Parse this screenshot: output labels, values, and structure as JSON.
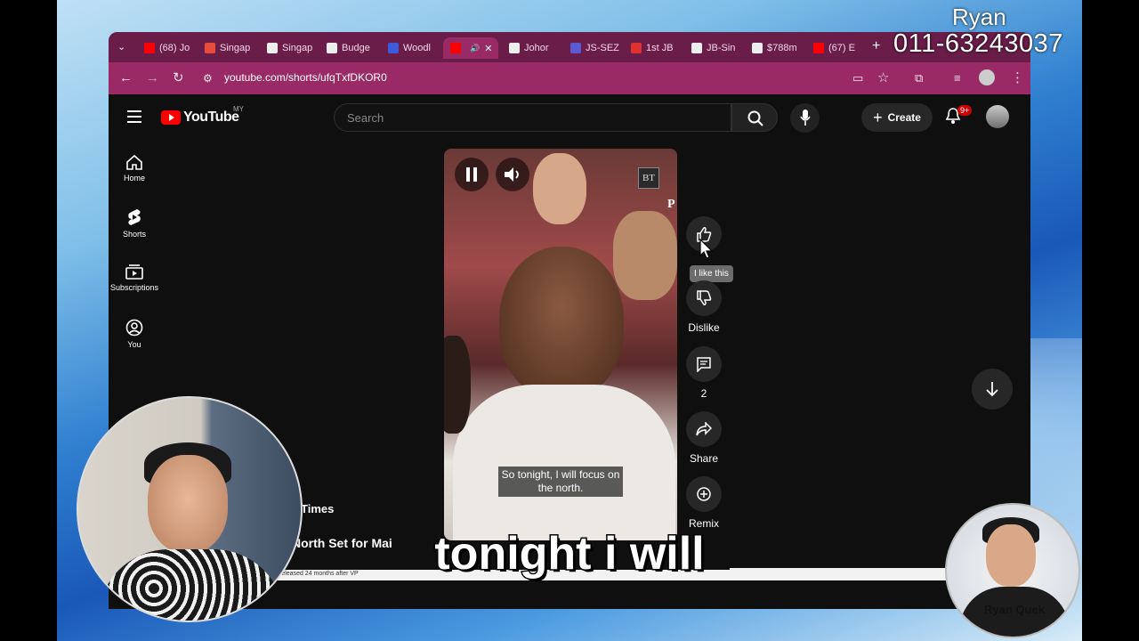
{
  "browser": {
    "tabs": [
      {
        "label": "(68) Jo",
        "fav_color": "#ff0000",
        "icon": "youtube-icon"
      },
      {
        "label": "Singap",
        "fav_color": "#e84c3d",
        "icon": "site-icon"
      },
      {
        "label": "Singap",
        "fav_color": "#eeeeee",
        "icon": "bt-icon"
      },
      {
        "label": "Budge",
        "fav_color": "#eeeeee",
        "icon": "bt-icon"
      },
      {
        "label": "Woodl",
        "fav_color": "#3b5bdb",
        "icon": "e-icon"
      },
      {
        "label": "",
        "fav_color": "#ff0000",
        "icon": "youtube-icon",
        "active": true
      },
      {
        "label": "Johor",
        "fav_color": "#eeeeee",
        "icon": "bt-icon"
      },
      {
        "label": "JS-SEZ",
        "fav_color": "#5b5bd6",
        "icon": "site-icon"
      },
      {
        "label": "1st JB",
        "fav_color": "#e03131",
        "icon": "s-icon"
      },
      {
        "label": "JB-Sin",
        "fav_color": "#eeeeee",
        "icon": "st-icon"
      },
      {
        "label": "$788m",
        "fav_color": "#eeeeee",
        "icon": "st-icon"
      },
      {
        "label": "(67) E",
        "fav_color": "#ff0000",
        "icon": "youtube-icon"
      }
    ],
    "new_tab": "+",
    "url": "youtube.com/shorts/ufqTxfDKOR0",
    "accent": "#9a2a66",
    "tabbar_color": "#6b1d4a"
  },
  "youtube": {
    "logo_text": "YouTube",
    "region": "MY",
    "search_placeholder": "Search",
    "create_label": "Create",
    "notif_count": "9+",
    "nav": [
      {
        "label": "Home",
        "icon": "home-icon"
      },
      {
        "label": "Shorts",
        "icon": "shorts-icon"
      },
      {
        "label": "Subscriptions",
        "icon": "subscriptions-icon"
      },
      {
        "label": "You",
        "icon": "you-icon"
      }
    ],
    "short": {
      "subtitle": "So tonight, I will focus on the north.",
      "channel_badge": "BT",
      "channel_letter": "P"
    },
    "actions": {
      "like_tooltip": "I like this",
      "dislike_label": "Dislike",
      "comment_count": "2",
      "share_label": "Share",
      "remix_label": "Remix"
    },
    "behind_text_1": "Times",
    "behind_text_2": "North Set for Mai",
    "strip_text": "released 24 months after VP"
  },
  "overlay": {
    "name": "Ryan",
    "phone": "011-63243037",
    "caption": "tonight i will",
    "presenter_name": "Ryan Quek"
  }
}
